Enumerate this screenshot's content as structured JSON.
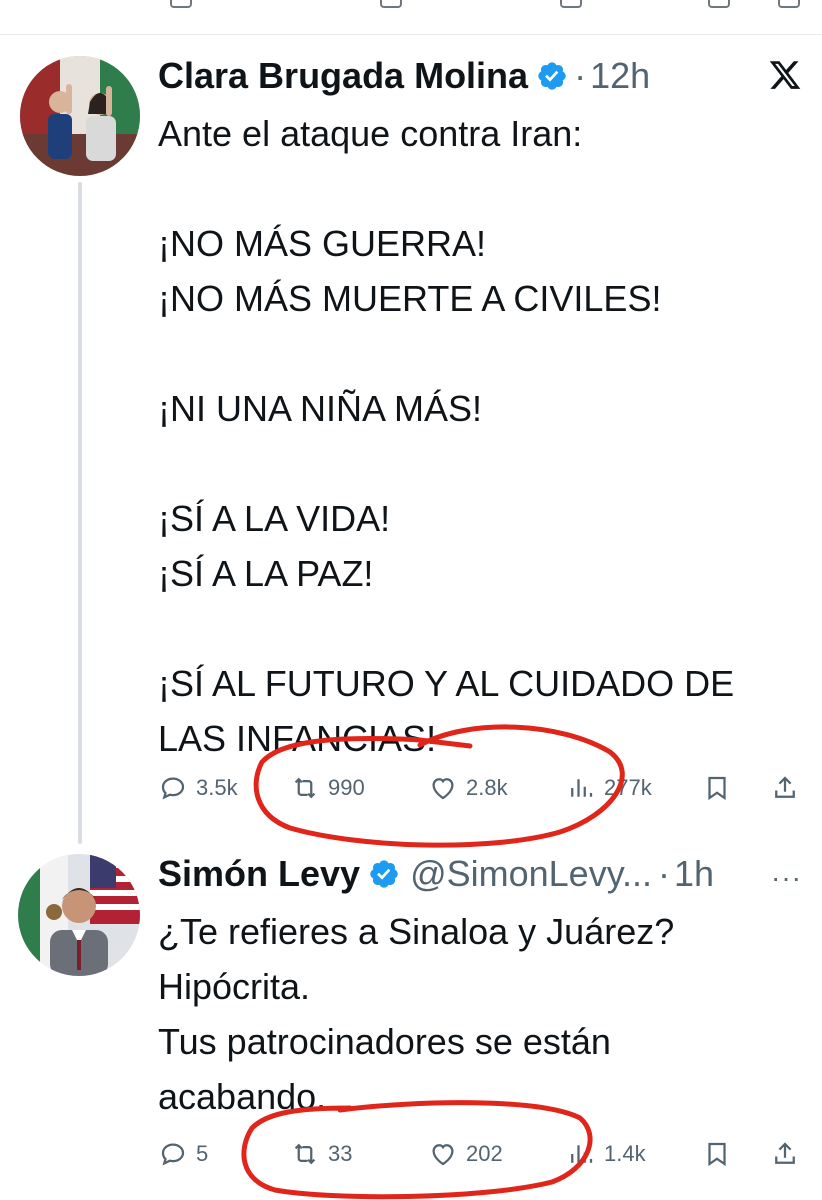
{
  "tweets": [
    {
      "author": "Clara Brugada Molina",
      "handle": "",
      "separator": "·",
      "time": "12h",
      "text": "Ante el ataque contra Iran:\n\n¡NO MÁS GUERRA!\n¡NO MÁS MUERTE A CIVILES!\n\n¡NI UNA NIÑA MÁS!\n\n¡SÍ A LA VIDA!\n¡SÍ A LA PAZ!\n\n¡SÍ AL FUTURO Y AL CUIDADO DE\nLAS INFANCIAS!",
      "stats": {
        "replies": "3.5k",
        "reposts": "990",
        "likes": "2.8k",
        "views": "277k"
      }
    },
    {
      "author": "Simón Levy",
      "handle": "@SimonLevy...",
      "separator": "·",
      "time": "1h",
      "text": "¿Te refieres a Sinaloa y Juárez?\nHipócrita.\nTus patrocinadores se están\nacabando.",
      "stats": {
        "replies": "5",
        "reposts": "33",
        "likes": "202",
        "views": "1.4k"
      }
    }
  ],
  "more_label": "···",
  "icons": {
    "brand": "x-logo-icon",
    "verified": "verified-badge-icon",
    "reply": "reply-icon",
    "repost": "repost-icon",
    "like": "like-icon",
    "views": "views-icon",
    "bookmark": "bookmark-icon",
    "share": "share-icon"
  },
  "colors": {
    "text": "#0f1419",
    "secondary": "#536471",
    "verified": "#1d9bf0",
    "annotation": "#e0261b"
  }
}
